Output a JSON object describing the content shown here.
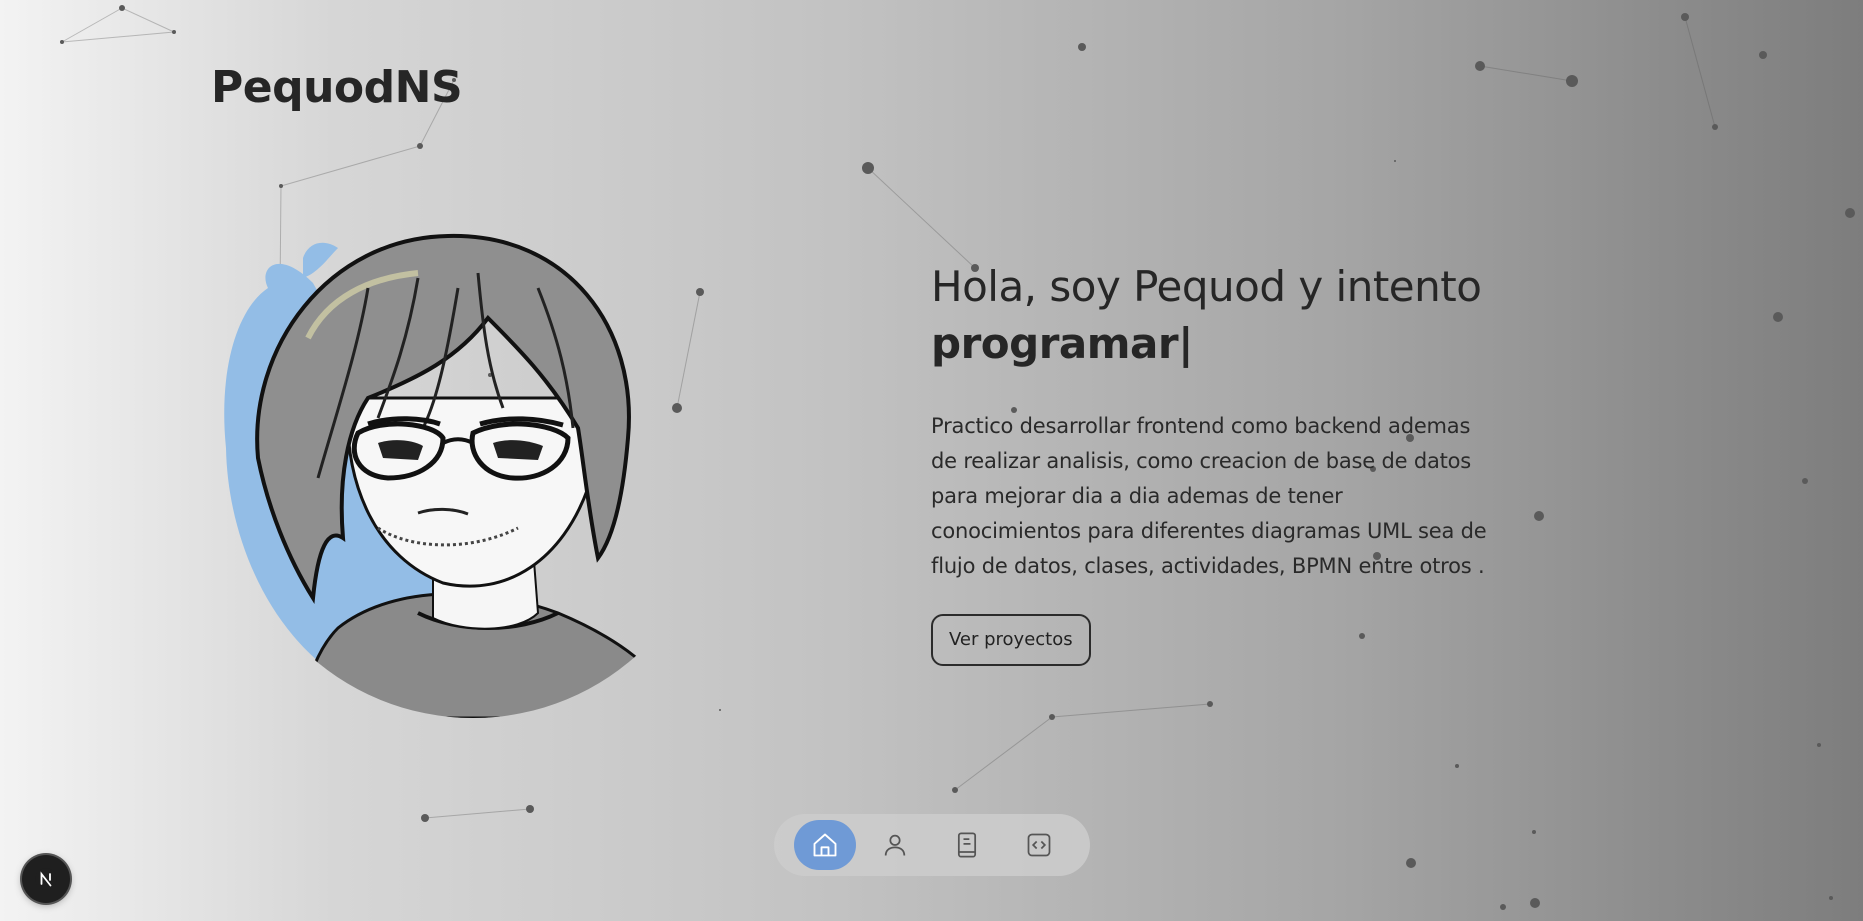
{
  "brand": {
    "name": "PequodNS"
  },
  "hero": {
    "heading_line1": "Hola, soy Pequod y intento",
    "heading_word": "programar",
    "caret": "|",
    "description": "Practico desarrollar frontend como backend ademas de realizar analisis, como creacion de base de datos para mejorar dia a dia ademas de tener conocimientos para diferentes diagramas UML sea de flujo de datos, clases, actividades, BPMN entre otros .",
    "cta_label": "Ver proyectos"
  },
  "dock": {
    "items": [
      {
        "icon": "home-icon",
        "active": true
      },
      {
        "icon": "user-icon",
        "active": false
      },
      {
        "icon": "book-icon",
        "active": false
      },
      {
        "icon": "code-icon",
        "active": false
      }
    ]
  },
  "nextjs_badge": {
    "letter": "N"
  },
  "colors": {
    "accent": "#6f9ad6",
    "text": "#262626",
    "avatar_blob": "#93bde6",
    "star": "#5a5a5a"
  }
}
